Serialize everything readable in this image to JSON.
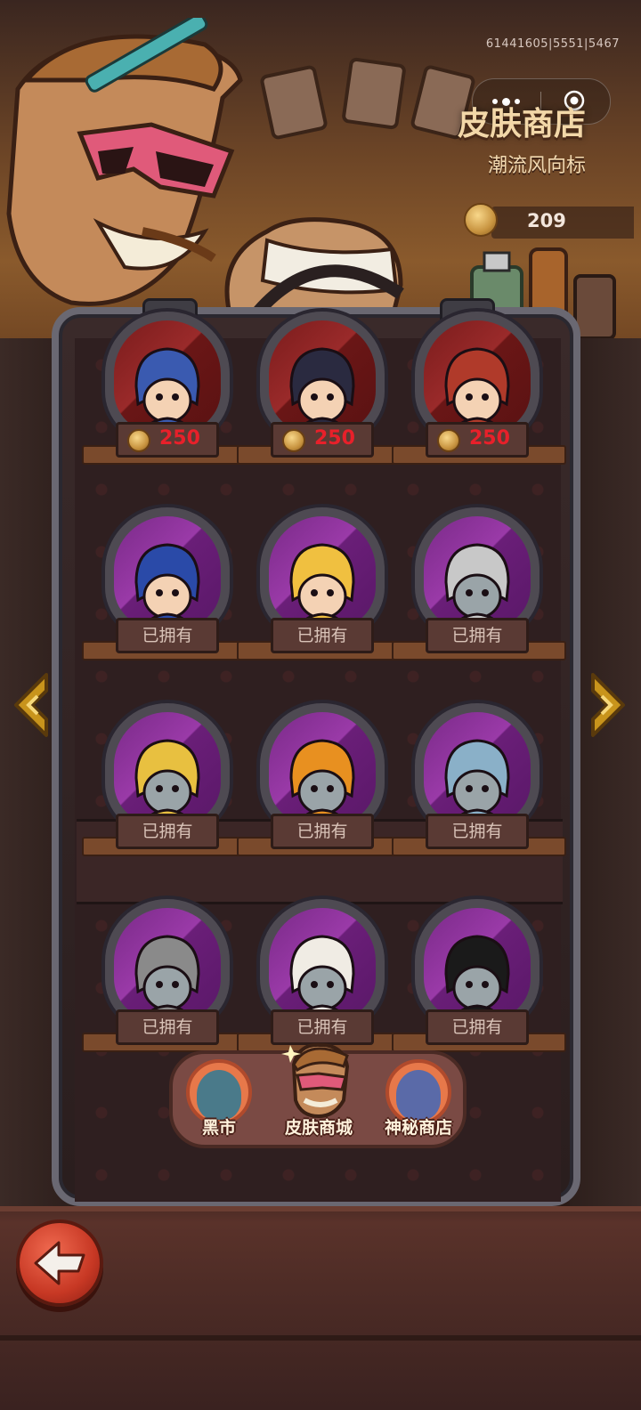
{
  "debug_id": "61441605|5551|5467",
  "header": {
    "title": "皮肤商店",
    "subtitle": "潮流风向标",
    "coins": "209"
  },
  "colors": {
    "price_text": "#e8202a",
    "owned_label_bg": "#5a3a34",
    "portrait_bg": "#8a2a98",
    "nav_circle": "#e7784a"
  },
  "items": [
    {
      "state": "price",
      "price": "250",
      "portrait": "blue-haired-girl"
    },
    {
      "state": "price",
      "price": "250",
      "portrait": "masked-shark"
    },
    {
      "state": "price",
      "price": "250",
      "portrait": "red-haired-beast"
    },
    {
      "state": "owned",
      "label": "已拥有",
      "portrait": "bunny-ear-girl"
    },
    {
      "state": "owned",
      "label": "已拥有",
      "portrait": "cat-mask-girl"
    },
    {
      "state": "owned",
      "label": "已拥有",
      "portrait": "chef-shark"
    },
    {
      "state": "owned",
      "label": "已拥有",
      "portrait": "jester-shark"
    },
    {
      "state": "owned",
      "label": "已拥有",
      "portrait": "hardhat-shark"
    },
    {
      "state": "owned",
      "label": "已拥有",
      "portrait": "bonnet-shark"
    },
    {
      "state": "owned",
      "label": "已拥有",
      "portrait": "armored-shark"
    },
    {
      "state": "owned",
      "label": "已拥有",
      "portrait": "chef-hat-man"
    },
    {
      "state": "owned",
      "label": "已拥有",
      "portrait": "pirate-shark"
    }
  ],
  "nav": {
    "black_market": "黑市",
    "skin_shop": "皮肤商城",
    "mystery_shop": "神秘商店"
  },
  "icons": {
    "back": "back-arrow-icon",
    "prev": "chevron-left-icon",
    "next": "chevron-right-icon",
    "coin": "coin-icon",
    "menu": "more-dots-icon",
    "close": "target-icon"
  }
}
